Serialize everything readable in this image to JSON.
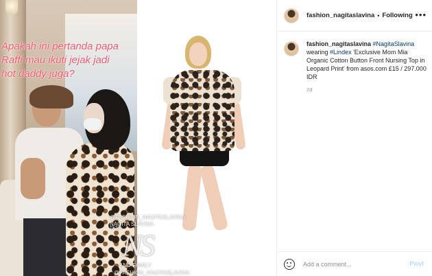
{
  "video": {
    "caption_lines": [
      "Apakah ini pertanda papa",
      "Raffi mau ikuti jejak jadi",
      "hot daddy juga?"
    ],
    "watermark": {
      "line1": "@FASHION_NAGITASLAVINA",
      "line2": "NAGITA SLAVINA",
      "tiktok": "TikTok",
      "logo": "NS",
      "line3": "AND FAMILY",
      "line4": "@FASHION_NAGITASLAVINA"
    }
  },
  "header": {
    "username": "fashion_nagitaslavina",
    "separator": "•",
    "follow_status": "Following",
    "more_icon": "more-horizontal-icon"
  },
  "post": {
    "username": "fashion_nagitaslavina",
    "hashtag_1": "#NagitaSlavina",
    "text_1": "wearing",
    "hashtag_2": "#Lindex",
    "text_2": "'Exclusive Mom Mia Organic Cotton Button Front Nursing Top in Leopard Print' from asos.com £15 / 297.000 IDR",
    "time": "2d"
  },
  "add_comment": {
    "emoji_icon": "emoji-smile-icon",
    "placeholder": "Add a comment...",
    "post_label": "Post"
  },
  "colors": {
    "caption_pink": "#f25a73",
    "link": "#00376b",
    "post_disabled": "#b2dffc",
    "muted": "#8e8e8e"
  }
}
